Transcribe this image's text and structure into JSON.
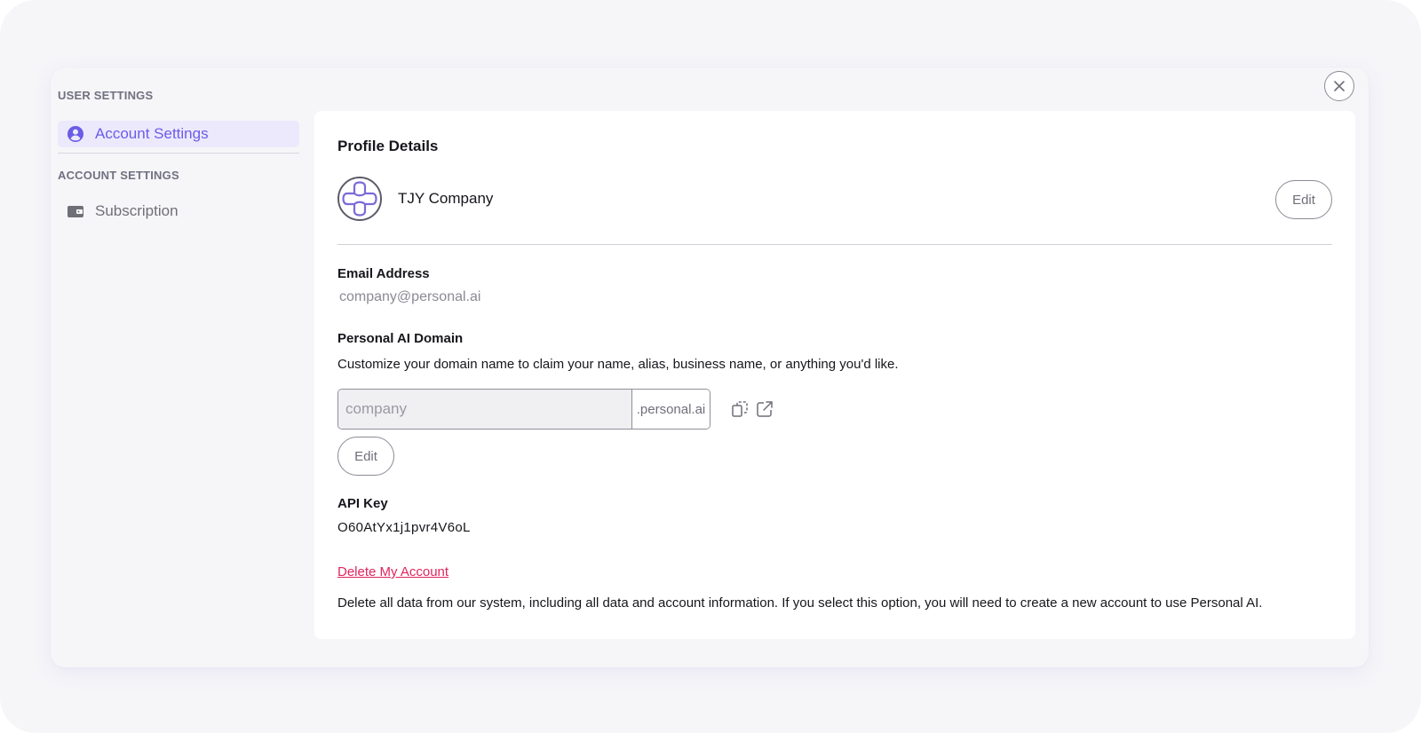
{
  "sidebar": {
    "user_settings_title": "USER SETTINGS",
    "account_settings_item": "Account Settings",
    "account_settings_title": "ACCOUNT SETTINGS",
    "subscription_item": "Subscription"
  },
  "profile": {
    "title": "Profile Details",
    "company_name": "TJY Company",
    "edit_label": "Edit"
  },
  "email": {
    "label": "Email Address",
    "value": "company@personal.ai"
  },
  "domain": {
    "label": "Personal AI Domain",
    "description": "Customize your domain name to claim your name, alias, business name, or anything you'd like.",
    "input_placeholder": "company",
    "suffix": ".personal.ai",
    "edit_label": "Edit"
  },
  "api_key": {
    "label": "API Key",
    "value": "O60AtYx1j1pvr4V6oL"
  },
  "delete": {
    "link_label": "Delete My Account",
    "description": "Delete all data from our system, including all data and account information. If you select this option, you will need to create a new account to use Personal AI."
  },
  "icons": {
    "close": "close-icon",
    "account": "user-circle-icon",
    "subscription": "wallet-icon",
    "avatar": "logo-icon",
    "copy": "copy-icon",
    "open": "external-link-icon"
  },
  "colors": {
    "accent": "#6b5ce7",
    "accent_bg": "#ece9fd",
    "danger": "#e0245e",
    "page_bg": "#f6f6f9"
  }
}
